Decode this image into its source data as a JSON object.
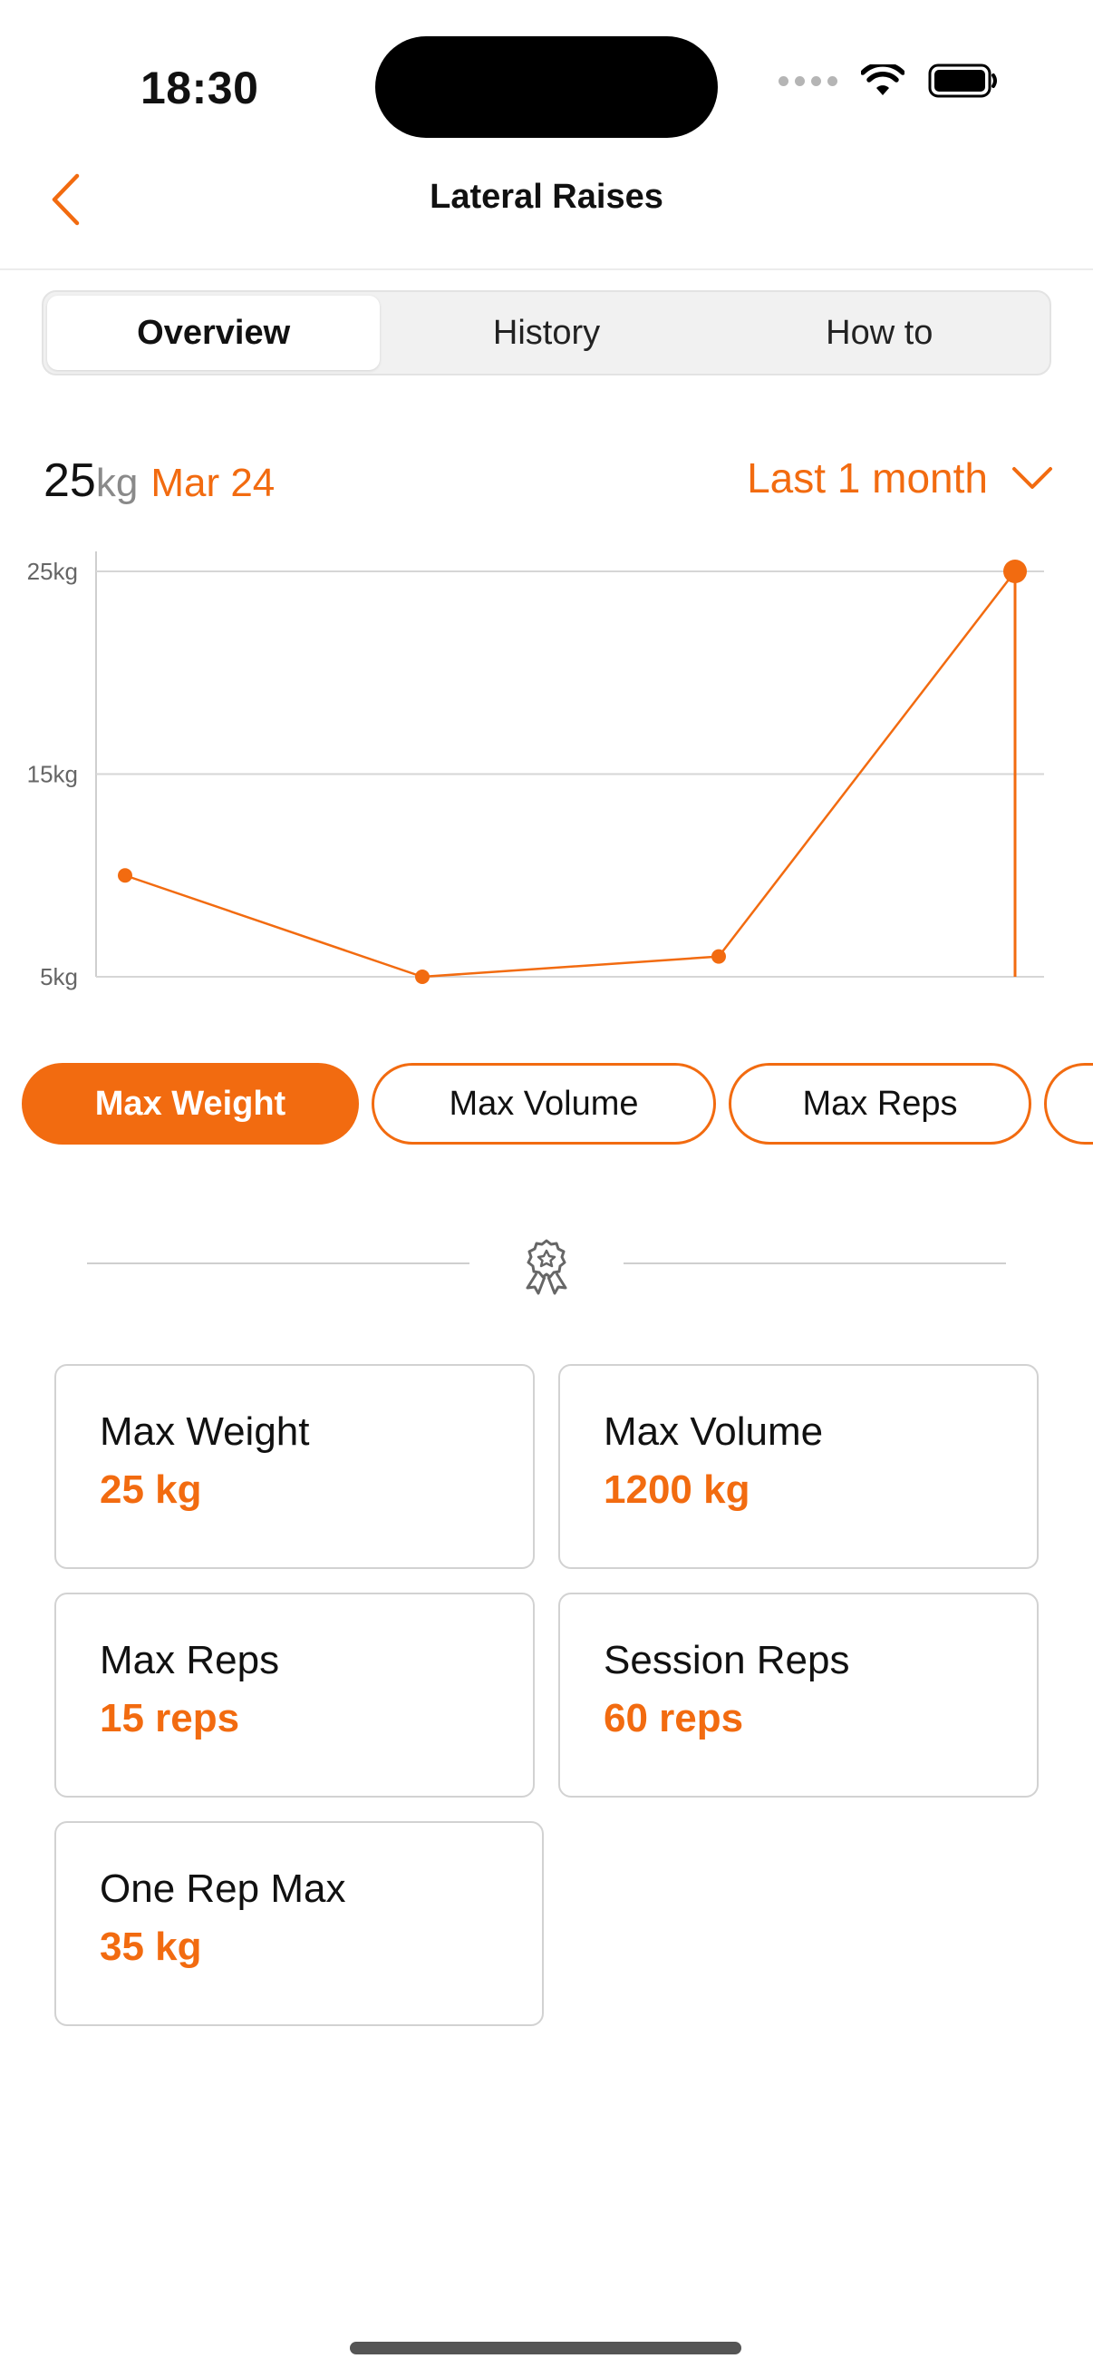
{
  "status_bar": {
    "time": "18:30"
  },
  "nav": {
    "title": "Lateral Raises"
  },
  "tabs": [
    {
      "label": "Overview",
      "active": true
    },
    {
      "label": "History",
      "active": false
    },
    {
      "label": "How to",
      "active": false
    }
  ],
  "summary": {
    "value": "25",
    "unit": "kg",
    "date": "Mar 24"
  },
  "range": {
    "label": "Last 1 month"
  },
  "chart_data": {
    "type": "line",
    "y_ticks": [
      "25kg",
      "15kg",
      "5kg"
    ],
    "ylim": [
      5,
      25
    ],
    "x": [
      1,
      2,
      3,
      4
    ],
    "values": [
      10,
      5,
      6,
      25
    ],
    "highlighted_index": 3,
    "color": "#f26b10"
  },
  "chips": [
    {
      "label": "Max Weight",
      "active": true
    },
    {
      "label": "Max Volume",
      "active": false
    },
    {
      "label": "Max Reps",
      "active": false
    }
  ],
  "stats": [
    {
      "label": "Max Weight",
      "value": "25 kg"
    },
    {
      "label": "Max Volume",
      "value": "1200 kg"
    },
    {
      "label": "Max Reps",
      "value": "15 reps"
    },
    {
      "label": "Session Reps",
      "value": "60 reps"
    },
    {
      "label": "One Rep Max",
      "value": "35 kg"
    }
  ],
  "colors": {
    "accent": "#f26b10"
  }
}
